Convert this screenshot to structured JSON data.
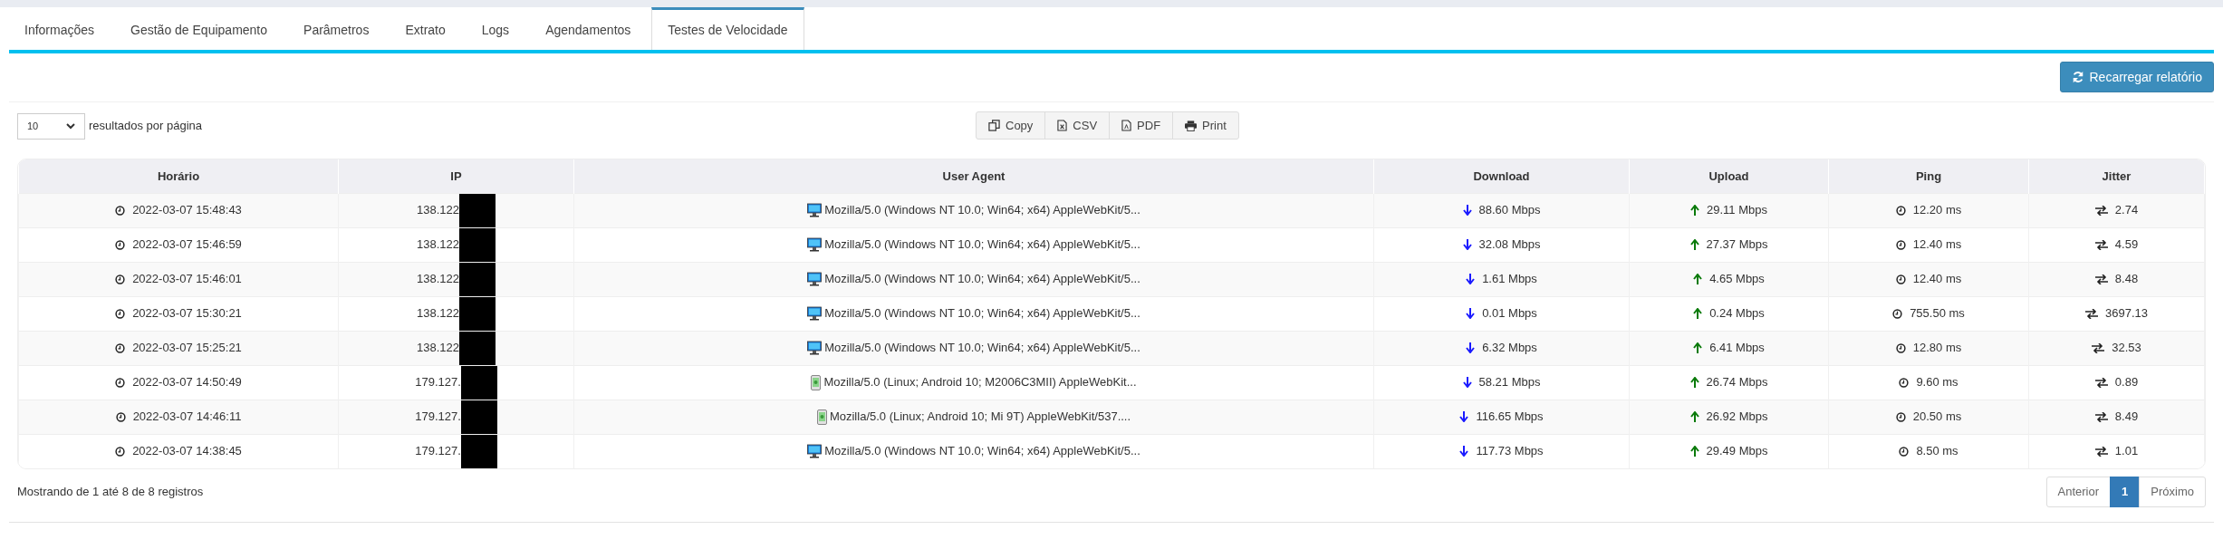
{
  "tabs": [
    {
      "label": "Informações",
      "selected": false
    },
    {
      "label": "Gestão de Equipamento",
      "selected": false
    },
    {
      "label": "Parâmetros",
      "selected": false
    },
    {
      "label": "Extrato",
      "selected": false
    },
    {
      "label": "Logs",
      "selected": false
    },
    {
      "label": "Agendamentos",
      "selected": false
    },
    {
      "label": "Testes de Velocidade",
      "selected": true
    }
  ],
  "reload_button": "Recarregar relatório",
  "page_size": {
    "value": "10",
    "label": "resultados por página"
  },
  "export_buttons": [
    {
      "kind": "copy",
      "label": "Copy"
    },
    {
      "kind": "csv",
      "label": "CSV"
    },
    {
      "kind": "pdf",
      "label": "PDF"
    },
    {
      "kind": "print",
      "label": "Print"
    }
  ],
  "table": {
    "columns": [
      "Horário",
      "IP",
      "User Agent",
      "Download",
      "Upload",
      "Ping",
      "Jitter"
    ],
    "rows": [
      {
        "time": "2022-03-07 15:48:43",
        "ip": "138.122",
        "kind": "desktop",
        "user_agent": "Mozilla/5.0 (Windows NT 10.0; Win64; x64) AppleWebKit/5...",
        "download": "88.60 Mbps",
        "upload": "29.11 Mbps",
        "ping": "12.20 ms",
        "jitter": "2.74"
      },
      {
        "time": "2022-03-07 15:46:59",
        "ip": "138.122",
        "kind": "desktop",
        "user_agent": "Mozilla/5.0 (Windows NT 10.0; Win64; x64) AppleWebKit/5...",
        "download": "32.08 Mbps",
        "upload": "27.37 Mbps",
        "ping": "12.40 ms",
        "jitter": "4.59"
      },
      {
        "time": "2022-03-07 15:46:01",
        "ip": "138.122",
        "kind": "desktop",
        "user_agent": "Mozilla/5.0 (Windows NT 10.0; Win64; x64) AppleWebKit/5...",
        "download": "1.61 Mbps",
        "upload": "4.65 Mbps",
        "ping": "12.40 ms",
        "jitter": "8.48"
      },
      {
        "time": "2022-03-07 15:30:21",
        "ip": "138.122",
        "kind": "desktop",
        "user_agent": "Mozilla/5.0 (Windows NT 10.0; Win64; x64) AppleWebKit/5...",
        "download": "0.01 Mbps",
        "upload": "0.24 Mbps",
        "ping": "755.50 ms",
        "jitter": "3697.13"
      },
      {
        "time": "2022-03-07 15:25:21",
        "ip": "138.122",
        "kind": "desktop",
        "user_agent": "Mozilla/5.0 (Windows NT 10.0; Win64; x64) AppleWebKit/5...",
        "download": "6.32 Mbps",
        "upload": "6.41 Mbps",
        "ping": "12.80 ms",
        "jitter": "32.53"
      },
      {
        "time": "2022-03-07 14:50:49",
        "ip": "179.127.",
        "kind": "mobile",
        "user_agent": "Mozilla/5.0 (Linux; Android 10; M2006C3MII) AppleWebKit...",
        "download": "58.21 Mbps",
        "upload": "26.74 Mbps",
        "ping": "9.60 ms",
        "jitter": "0.89"
      },
      {
        "time": "2022-03-07 14:46:11",
        "ip": "179.127.",
        "kind": "mobile",
        "user_agent": "Mozilla/5.0 (Linux; Android 10; Mi 9T) AppleWebKit/537....",
        "download": "116.65 Mbps",
        "upload": "26.92 Mbps",
        "ping": "20.50 ms",
        "jitter": "8.49"
      },
      {
        "time": "2022-03-07 14:38:45",
        "ip": "179.127.",
        "kind": "desktop",
        "user_agent": "Mozilla/5.0 (Windows NT 10.0; Win64; x64) AppleWebKit/5...",
        "download": "117.73 Mbps",
        "upload": "29.49 Mbps",
        "ping": "8.50 ms",
        "jitter": "1.01"
      }
    ]
  },
  "summary": "Mostrando de 1 até 8 de 8 registros",
  "pagination": [
    {
      "label": "Anterior",
      "selected": false
    },
    {
      "label": "1",
      "selected": true
    },
    {
      "label": "Próximo",
      "selected": false
    }
  ]
}
